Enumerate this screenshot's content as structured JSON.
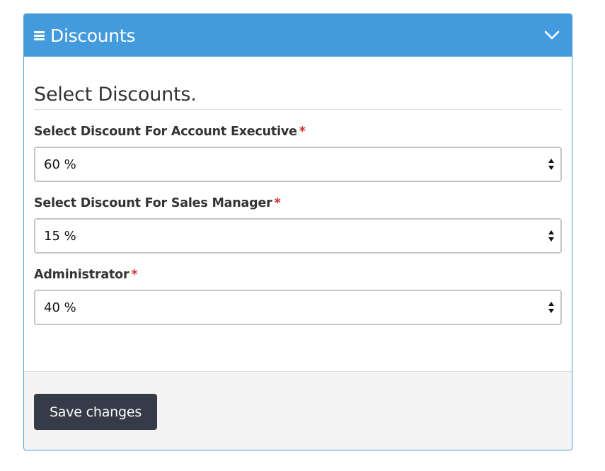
{
  "panel": {
    "title": "Discounts",
    "header_color": "#439bdd",
    "collapse_icon": "chevron-down-icon",
    "menu_icon": "hamburger-icon"
  },
  "form": {
    "heading": "Select Discounts.",
    "fields": [
      {
        "label": "Select Discount For Account Executive",
        "required_mark": "*",
        "value": "60 %"
      },
      {
        "label": "Select Discount For Sales Manager",
        "required_mark": "*",
        "value": "15 %"
      },
      {
        "label": "Administrator",
        "required_mark": "*",
        "value": "40 %"
      }
    ]
  },
  "footer": {
    "save_label": "Save changes",
    "save_color": "#353b48"
  }
}
